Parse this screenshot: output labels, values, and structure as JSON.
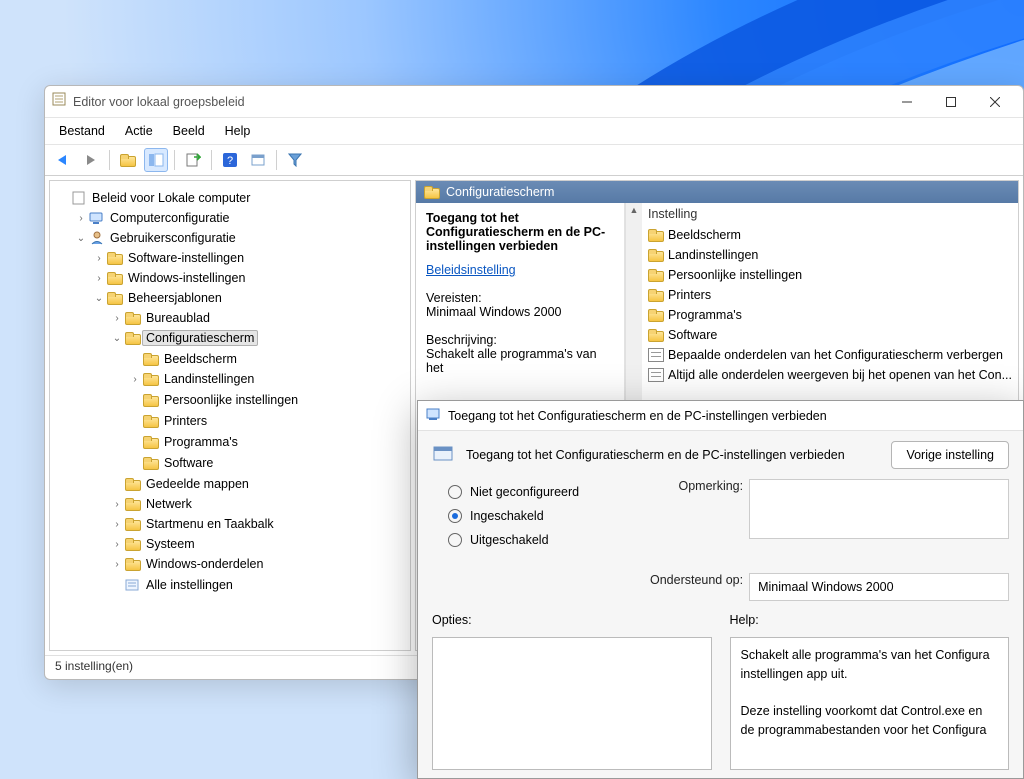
{
  "window": {
    "title": "Editor voor lokaal groepsbeleid",
    "minimize": "–",
    "maximize": "▢",
    "close": "✕"
  },
  "menu": {
    "file": "Bestand",
    "action": "Actie",
    "view": "Beeld",
    "help": "Help"
  },
  "tree": {
    "root": "Beleid voor Lokale computer",
    "compCfg": "Computerconfiguratie",
    "userCfg": "Gebruikersconfiguratie",
    "sw": "Software-instellingen",
    "win": "Windows-instellingen",
    "admx": "Beheersjablonen",
    "desk": "Bureaublad",
    "cpl": "Configuratiescherm",
    "display": "Beeldscherm",
    "region": "Landinstellingen",
    "personal": "Persoonlijke instellingen",
    "printers": "Printers",
    "programs": "Programma's",
    "software": "Software",
    "shared": "Gedeelde mappen",
    "network": "Netwerk",
    "startmenu": "Startmenu en Taakbalk",
    "system": "Systeem",
    "wincomp": "Windows-onderdelen",
    "allset": "Alle instellingen"
  },
  "content": {
    "header": "Configuratiescherm",
    "selected_title": "Toegang tot het Configuratiescherm en de PC-instellingen verbieden",
    "link": "Beleidsinstelling",
    "reqLabel": "Vereisten:",
    "reqValue": "Minimaal Windows 2000",
    "descLabel": "Beschrijving:",
    "descValue": "Schakelt alle programma's van het",
    "colInstelling": "Instelling",
    "items": {
      "display": "Beeldscherm",
      "region": "Landinstellingen",
      "personal": "Persoonlijke instellingen",
      "printers": "Printers",
      "programs": "Programma's",
      "software": "Software",
      "policy1": "Bepaalde onderdelen van het Configuratiescherm verbergen",
      "policy2": "Altijd alle onderdelen weergeven bij het openen van het Con..."
    }
  },
  "status": "5 instelling(en)",
  "dialog": {
    "winTitle": "Toegang tot het Configuratiescherm en de PC-instellingen verbieden",
    "headerTitle": "Toegang tot het Configuratiescherm en de PC-instellingen verbieden",
    "prevBtn": "Vorige instelling",
    "radio_notcfg": "Niet geconfigureerd",
    "radio_on": "Ingeschakeld",
    "radio_off": "Uitgeschakeld",
    "commentLabel": "Opmerking:",
    "supportLabel": "Ondersteund op:",
    "supportValue": "Minimaal Windows 2000",
    "optionsLabel": "Opties:",
    "helpLabel": "Help:",
    "helpP1": "Schakelt alle programma's van het Configura instellingen app uit.",
    "helpP2": "Deze instelling voorkomt dat Control.exe en de programmabestanden voor het Configura"
  }
}
